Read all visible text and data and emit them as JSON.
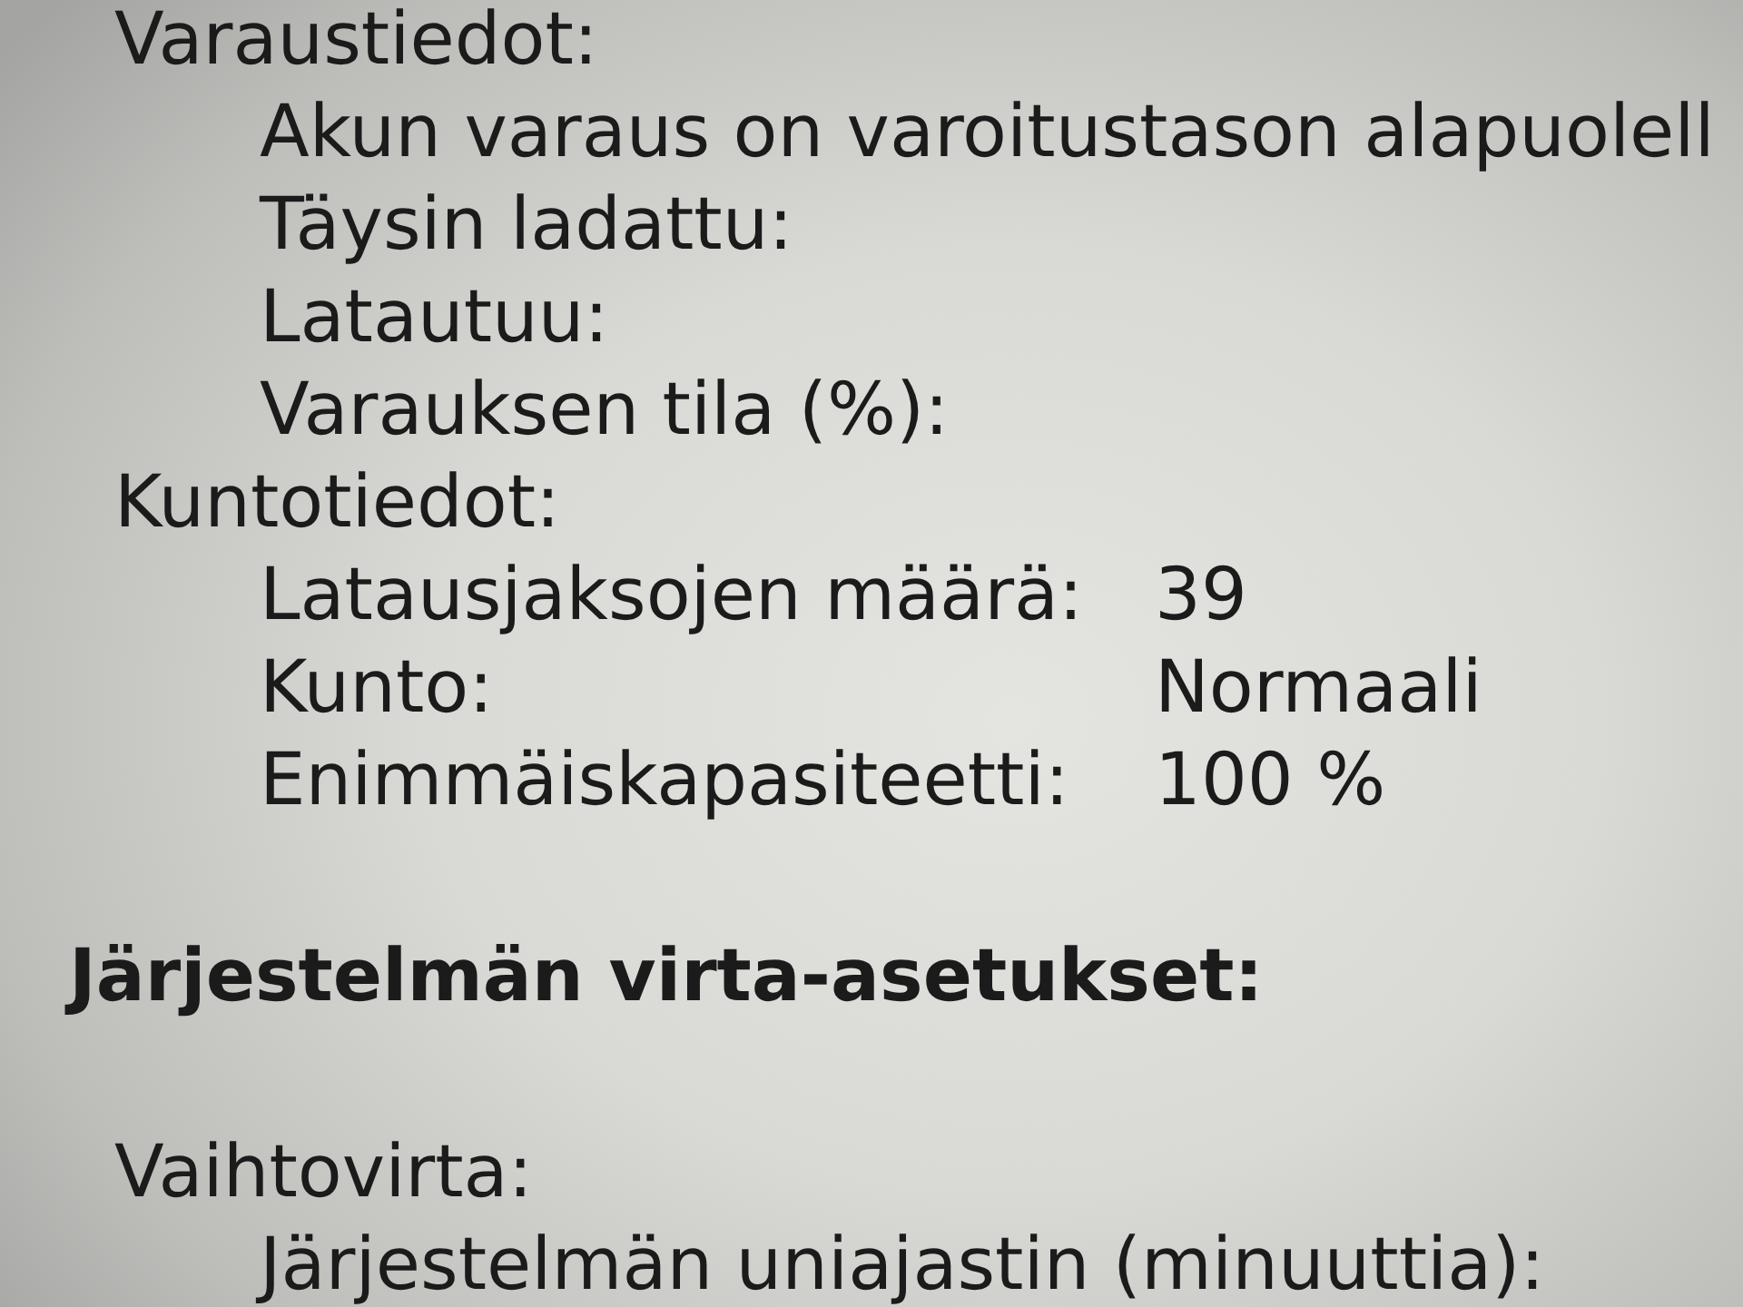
{
  "info_groups": [
    {
      "title": "Varaustiedot:",
      "rows": [
        {
          "label": "Akun varaus on varoitustason alapuolell"
        },
        {
          "label": "Täysin ladattu:"
        },
        {
          "label": "Latautuu:"
        },
        {
          "label": "Varauksen tila (%):"
        }
      ]
    },
    {
      "title": "Kuntotiedot:",
      "rows": [
        {
          "label": "Latausjaksojen määrä:",
          "value": "39"
        },
        {
          "label": "Kunto:",
          "value": "Normaali"
        },
        {
          "label": "Enimmäiskapasiteetti:",
          "value": "100 %"
        }
      ]
    }
  ],
  "power_settings": {
    "heading": "Järjestelmän virta-asetukset:",
    "groups": [
      {
        "title": "Vaihtovirta:",
        "rows": [
          {
            "label": "Järjestelmän uniajastin (minuuttia):"
          }
        ]
      }
    ]
  }
}
